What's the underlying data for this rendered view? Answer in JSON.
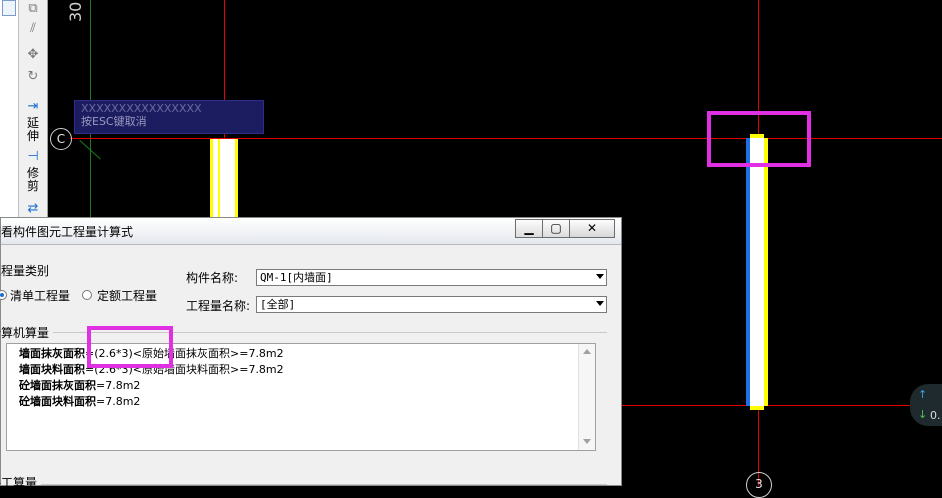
{
  "canvas": {
    "axis_number": "30",
    "bubble_c": "C",
    "bubble_3": "3",
    "tip_line1": "XXXXXXXXXXXXXXXX",
    "tip_line2": "按ESC键取消",
    "nav_up": "↑",
    "nav_down": "↓",
    "nav_value": "0."
  },
  "toolbar": {
    "extend_label": "延伸",
    "trim_label": "修剪"
  },
  "dialog": {
    "title": "查看构件图元工程量计算式",
    "min_glyph": "▁",
    "max_glyph": "▢",
    "close_glyph": "✕",
    "quantity_type_label": "工程量类别",
    "radio_list": "清单工程量",
    "radio_quota": "定额工程量",
    "component_name_label": "构件名称:",
    "component_name_value": "QM-1[内墙面]",
    "quantity_name_label": "工程量名称:",
    "quantity_name_value": "[全部]",
    "computer_section": "计算机算量",
    "manual_section": "手工算量",
    "lines": [
      {
        "name": "墙面抹灰面积",
        "formula": "=(2.6*3)<原始墙面抹灰面积>=7.8m2"
      },
      {
        "name": "墙面块料面积",
        "formula": "=(2.6*3)<原始墙面块料面积>=7.8m2"
      },
      {
        "name": "砼墙面抹灰面积",
        "formula": "=7.8m2"
      },
      {
        "name": "砼墙面块料面积",
        "formula": "=7.8m2"
      }
    ]
  },
  "colors": {
    "highlight": "#e12fe3",
    "axis_red": "#e00000",
    "axis_green": "#1d7a1d",
    "wall_yellow": "#ffff00",
    "wall_blue": "#1e6fe0"
  }
}
